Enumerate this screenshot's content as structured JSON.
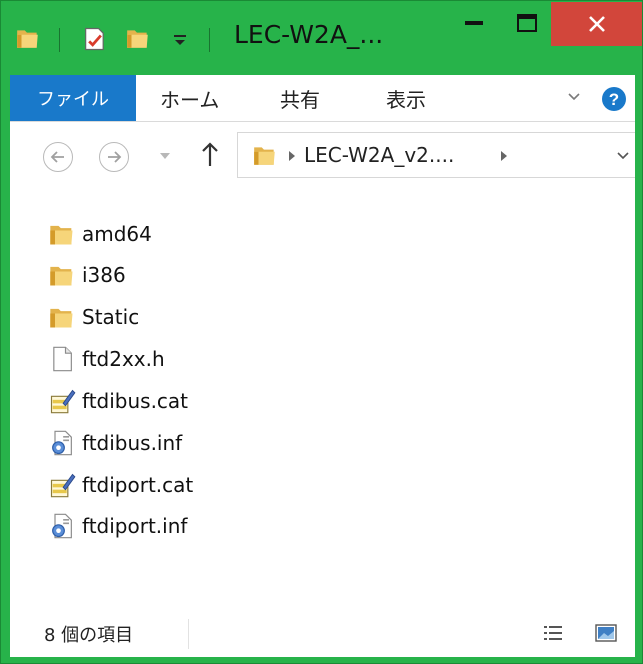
{
  "window": {
    "title": "LEC-W2A_...",
    "colors": {
      "frame": "#27b34a",
      "close": "#d2463b",
      "accent": "#1979ca"
    }
  },
  "ribbon": {
    "tabs": [
      {
        "label": "ファイル",
        "active": true
      },
      {
        "label": "ホーム"
      },
      {
        "label": "共有"
      },
      {
        "label": "表示"
      }
    ],
    "help_symbol": "?"
  },
  "address": {
    "path": "LEC-W2A_v2...."
  },
  "files": [
    {
      "name": "amd64",
      "icon": "folder-icon"
    },
    {
      "name": "i386",
      "icon": "folder-icon"
    },
    {
      "name": "Static",
      "icon": "folder-icon"
    },
    {
      "name": "ftd2xx.h",
      "icon": "file-icon"
    },
    {
      "name": "ftdibus.cat",
      "icon": "catalog-icon"
    },
    {
      "name": "ftdibus.inf",
      "icon": "setup-info-icon"
    },
    {
      "name": "ftdiport.cat",
      "icon": "catalog-icon"
    },
    {
      "name": "ftdiport.inf",
      "icon": "setup-info-icon"
    }
  ],
  "status": {
    "item_count": "8 個の項目"
  }
}
